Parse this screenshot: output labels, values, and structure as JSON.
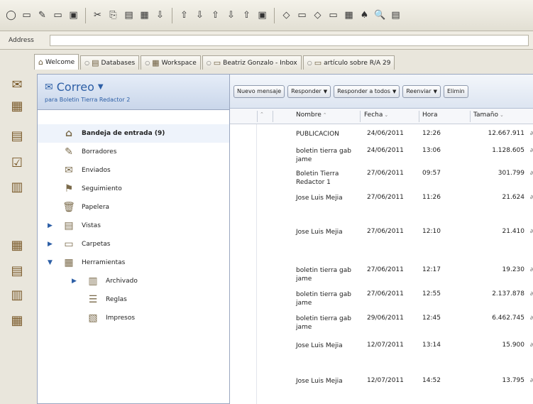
{
  "toolbar": {
    "buttons": [
      "◯",
      "▭",
      "✎",
      "▭",
      "▣",
      "✂",
      "⎘",
      "▤",
      "▦",
      "⇩",
      "⇧",
      "⇩",
      "⇧",
      "⇩",
      "⇧",
      "▣",
      "◇",
      "▭",
      "◇",
      "▭",
      "▦",
      "♠",
      "🔍",
      "▤"
    ]
  },
  "address": {
    "label": "Address",
    "value": ""
  },
  "tabs": [
    {
      "label": "Welcome",
      "active": true
    },
    {
      "label": "Databases"
    },
    {
      "label": "Workspace"
    },
    {
      "label": "Beatriz Gonzalo - Inbox"
    },
    {
      "label": "artículo sobre R/A 29"
    }
  ],
  "launcher": {
    "icons": [
      "mail-icon",
      "calendar-icon",
      "contacts-icon",
      "todo-icon",
      "notebook-icon",
      "folder-icon",
      "replicator-icon",
      "database-icon",
      "workspace-icon"
    ]
  },
  "nav": {
    "title": "Correo",
    "subtitle": "para Boletin Tierra Redactor 2",
    "items": [
      {
        "label": "Bandeja de entrada (9)",
        "icon": "inbox-icon",
        "bold": true,
        "selected": true
      },
      {
        "label": "Borradores",
        "icon": "drafts-icon"
      },
      {
        "label": "Enviados",
        "icon": "sent-icon"
      },
      {
        "label": "Seguimiento",
        "icon": "followup-icon"
      },
      {
        "label": "Papelera",
        "icon": "trash-icon"
      },
      {
        "label": "Vistas",
        "icon": "views-icon",
        "arrow": "right"
      },
      {
        "label": "Carpetas",
        "icon": "folders-icon",
        "arrow": "right"
      },
      {
        "label": "Herramientas",
        "icon": "tools-icon",
        "arrow": "down"
      },
      {
        "label": "Archivado",
        "icon": "archive-icon",
        "arrow": "right",
        "indent": true
      },
      {
        "label": "Reglas",
        "icon": "rules-icon",
        "indent": true
      },
      {
        "label": "Impresos",
        "icon": "stationery-icon",
        "indent": true
      }
    ]
  },
  "actions": [
    {
      "label": "Nuevo mensaje"
    },
    {
      "label": "Responder",
      "dropdown": true
    },
    {
      "label": "Responder a todos",
      "dropdown": true
    },
    {
      "label": "Reenviar",
      "dropdown": true
    },
    {
      "label": "Elimin"
    }
  ],
  "columns": {
    "name": "Nombre",
    "date": "Fecha",
    "time": "Hora",
    "size": "Tamaño"
  },
  "messages": [
    {
      "name": "PUBLICACION",
      "date": "24/06/2011",
      "time": "12:26",
      "size": "12.667.911"
    },
    {
      "name": "boletin tierra gab jame",
      "date": "24/06/2011",
      "time": "13:06",
      "size": "1.128.605"
    },
    {
      "name": "Boletin Tierra Redactor 1",
      "date": "27/06/2011",
      "time": "09:57",
      "size": "301.799"
    },
    {
      "name": "Jose Luis Mejia",
      "date": "27/06/2011",
      "time": "11:26",
      "size": "21.624"
    },
    {
      "name": "Jose Luis Mejia",
      "date": "27/06/2011",
      "time": "12:10",
      "size": "21.410"
    },
    {
      "name": "boletin tierra gab jame",
      "date": "27/06/2011",
      "time": "12:17",
      "size": "19.230"
    },
    {
      "name": "boletin tierra gab jame",
      "date": "27/06/2011",
      "time": "12:55",
      "size": "2.137.878"
    },
    {
      "name": "boletin tierra gab jame",
      "date": "29/06/2011",
      "time": "12:45",
      "size": "6.462.745"
    },
    {
      "name": "Jose Luis Mejia",
      "date": "12/07/2011",
      "time": "13:14",
      "size": "15.900"
    },
    {
      "name": "Jose Luis Mejia",
      "date": "12/07/2011",
      "time": "14:52",
      "size": "13.795"
    }
  ]
}
